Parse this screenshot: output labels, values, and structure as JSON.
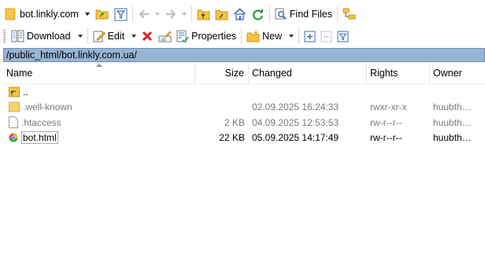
{
  "toolbar1": {
    "drive_label": "bot.linkly.com",
    "find_files_label": "Find Files",
    "icons": [
      "folder-icon",
      "open-folder-icon",
      "filter-icon",
      "back-icon",
      "forward-icon",
      "parent-dir-icon",
      "root-dir-icon",
      "home-icon",
      "refresh-icon",
      "find-files-icon",
      "tree-icon"
    ]
  },
  "toolbar2": {
    "download_label": "Download",
    "edit_label": "Edit",
    "properties_label": "Properties",
    "new_label": "New"
  },
  "path": "/public_html/bot.linkly.com.ua/",
  "columns": {
    "name": "Name",
    "size": "Size",
    "changed": "Changed",
    "rights": "Rights",
    "owner": "Owner"
  },
  "files": [
    {
      "name": "..",
      "size": "",
      "changed": "",
      "rights": "",
      "owner": "",
      "icon": "parent-folder-icon"
    },
    {
      "name": ".well-known",
      "size": "",
      "changed": "02.09.2025 16:24:33",
      "rights": "rwxr-xr-x",
      "owner": "huubth…",
      "icon": "folder-icon"
    },
    {
      "name": ".htaccess",
      "size": "2 KB",
      "changed": "04.09.2025 12:53:53",
      "rights": "rw-r--r--",
      "owner": "huubth…",
      "icon": "file-icon"
    },
    {
      "name": "bot.html",
      "size": "22 KB",
      "changed": "05.09.2025 14:17:49",
      "rights": "rw-r--r--",
      "owner": "huubth…",
      "icon": "html-file-icon"
    }
  ],
  "colors": {
    "path_bar_bg": "#98b4d4",
    "folder_yellow": "#f5c542",
    "refresh_green": "#2e9b3a",
    "delete_red": "#d62020",
    "icon_blue": "#3a6fb6"
  }
}
